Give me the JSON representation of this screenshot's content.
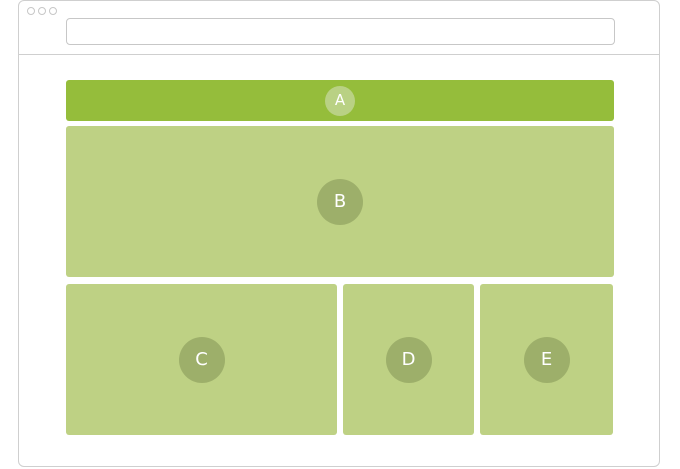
{
  "layout_blocks": [
    {
      "label": "A"
    },
    {
      "label": "B"
    },
    {
      "label": "C"
    },
    {
      "label": "D"
    },
    {
      "label": "E"
    }
  ],
  "colors": {
    "header_block": "#95bd3b",
    "content_block": "#bed184",
    "badge": "#9daf6a",
    "header_badge": "#b9d184",
    "badge_text": "#ffffff"
  }
}
